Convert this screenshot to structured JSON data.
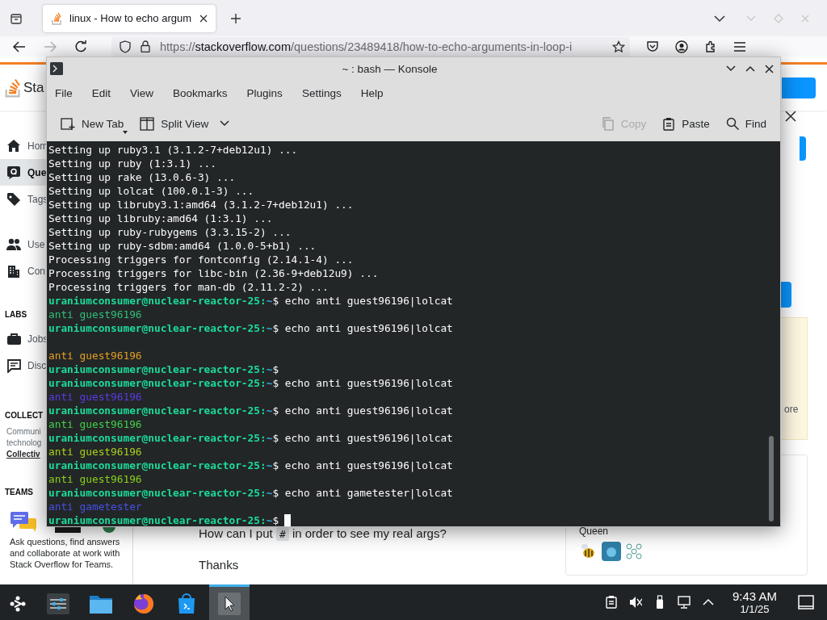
{
  "browser": {
    "tab": {
      "title": "linux - How to echo argum",
      "selected": true
    },
    "url": {
      "scheme": "https://",
      "host": "stackoverflow.com",
      "path": "/questions/23489418/how-to-echo-arguments-in-loop-i"
    }
  },
  "page": {
    "logo_text": "Sta",
    "nav": [
      {
        "kind": "home",
        "label": "Hom",
        "selected": false
      },
      {
        "kind": "questions",
        "label": "Que",
        "selected": true
      },
      {
        "kind": "tags",
        "label": "Tags",
        "selected": false
      },
      {
        "kind": "users",
        "label": "Use",
        "selected": false
      },
      {
        "kind": "companies",
        "label": "Con",
        "selected": false
      }
    ],
    "labs_heading": "LABS",
    "labs": [
      {
        "kind": "jobs",
        "label": "Jobs",
        "selected": false
      },
      {
        "kind": "discussions",
        "label": "Disc",
        "selected": false
      }
    ],
    "collectives_heading": "COLLECT",
    "collectives_text": [
      "Communi",
      "technolog"
    ],
    "collectives_link": "Collectiv",
    "teams_heading": "TEAMS",
    "teams_text": "Ask questions, find answers and collaborate at work with Stack Overflow for Teams.",
    "question": {
      "before": "How can I put",
      "code": "#",
      "after": "in order to see my real args?"
    },
    "thanks": "Thanks",
    "aside_fragment": "ore",
    "aside_user": "Queen"
  },
  "konsole": {
    "title": "~ : bash — Konsole",
    "menu": [
      "File",
      "Edit",
      "View",
      "Bookmarks",
      "Plugins",
      "Settings",
      "Help"
    ],
    "toolbar_left": [
      {
        "kind": "new_tab",
        "label": "New Tab"
      },
      {
        "kind": "split_view",
        "label": "Split View"
      }
    ],
    "toolbar_right": [
      {
        "kind": "copy",
        "label": "Copy",
        "disabled": true
      },
      {
        "kind": "paste",
        "label": "Paste",
        "disabled": false
      },
      {
        "kind": "find",
        "label": "Find",
        "disabled": false
      }
    ],
    "lines": [
      {
        "kind": "output",
        "text": "Setting up ruby3.1 (3.1.2-7+deb12u1) ..."
      },
      {
        "kind": "output",
        "text": "Setting up ruby (1:3.1) ..."
      },
      {
        "kind": "output",
        "text": "Setting up rake (13.0.6-3) ..."
      },
      {
        "kind": "output",
        "text": "Setting up lolcat (100.0.1-3) ..."
      },
      {
        "kind": "output",
        "text": "Setting up libruby3.1:amd64 (3.1.2-7+deb12u1) ..."
      },
      {
        "kind": "output",
        "text": "Setting up libruby:amd64 (1:3.1) ..."
      },
      {
        "kind": "output",
        "text": "Setting up ruby-rubygems (3.3.15-2) ..."
      },
      {
        "kind": "output",
        "text": "Setting up ruby-sdbm:amd64 (1.0.0-5+b1) ..."
      },
      {
        "kind": "output",
        "text": "Processing triggers for fontconfig (2.14.1-4) ..."
      },
      {
        "kind": "output",
        "text": "Processing triggers for libc-bin (2.36-9+deb12u9) ..."
      },
      {
        "kind": "output",
        "text": "Processing triggers for man-db (2.11.2-2) ..."
      },
      {
        "kind": "prompt",
        "user_host": "uraniumconsumer@nuclear-reactor-25:",
        "path": "~",
        "command": "$ echo anti guest96196|lolcat",
        "cursor": false
      },
      {
        "kind": "output",
        "text": "anti guest96196",
        "color": "#2fbf7a"
      },
      {
        "kind": "prompt",
        "user_host": "uraniumconsumer@nuclear-reactor-25:",
        "path": "~",
        "command": "$ echo anti guest96196|lolcat",
        "cursor": false
      },
      {
        "kind": "blank"
      },
      {
        "kind": "output",
        "text": "anti guest96196",
        "color": "#e0a020"
      },
      {
        "kind": "prompt",
        "user_host": "uraniumconsumer@nuclear-reactor-25:",
        "path": "~",
        "command": "$",
        "cursor": false
      },
      {
        "kind": "prompt",
        "user_host": "uraniumconsumer@nuclear-reactor-25:",
        "path": "~",
        "command": "$ echo anti guest96196|lolcat",
        "cursor": false
      },
      {
        "kind": "output",
        "text": "anti guest96196",
        "color": "#5a3ae6"
      },
      {
        "kind": "prompt",
        "user_host": "uraniumconsumer@nuclear-reactor-25:",
        "path": "~",
        "command": "$ echo anti guest96196|lolcat",
        "cursor": false
      },
      {
        "kind": "output",
        "text": "anti guest96196",
        "color": "#3fd048"
      },
      {
        "kind": "prompt",
        "user_host": "uraniumconsumer@nuclear-reactor-25:",
        "path": "~",
        "command": "$ echo anti guest96196|lolcat",
        "cursor": false
      },
      {
        "kind": "output",
        "text": "anti guest96196",
        "color": "#a6d21c"
      },
      {
        "kind": "prompt",
        "user_host": "uraniumconsumer@nuclear-reactor-25:",
        "path": "~",
        "command": "$ echo anti guest96196|lolcat",
        "cursor": false
      },
      {
        "kind": "output",
        "text": "anti guest96196",
        "color": "#88d018"
      },
      {
        "kind": "prompt",
        "user_host": "uraniumconsumer@nuclear-reactor-25:",
        "path": "~",
        "command": "$ echo anti gametester|lolcat",
        "cursor": false
      },
      {
        "kind": "output",
        "text": "anti gametester",
        "color": "#4650e8"
      },
      {
        "kind": "prompt",
        "user_host": "uraniumconsumer@nuclear-reactor-25:",
        "path": "~",
        "command": "$",
        "cursor": true
      }
    ]
  },
  "taskbar": {
    "tasks": [
      {
        "kind": "launcher",
        "selected": false
      },
      {
        "kind": "settings",
        "selected": false
      },
      {
        "kind": "files",
        "selected": false
      },
      {
        "kind": "firefox",
        "selected": false
      },
      {
        "kind": "store",
        "selected": false
      },
      {
        "kind": "konsole",
        "selected": true
      }
    ],
    "tray": [
      {
        "kind": "clipboard"
      },
      {
        "kind": "volume_muted"
      },
      {
        "kind": "usb"
      },
      {
        "kind": "network"
      },
      {
        "kind": "expand"
      }
    ],
    "time": "9:43 AM",
    "date": "1/1/25"
  }
}
